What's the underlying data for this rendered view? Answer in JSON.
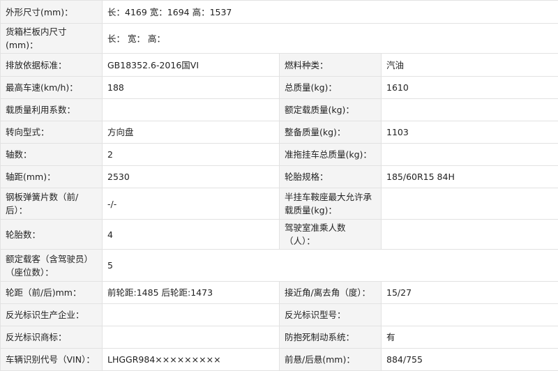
{
  "rows": [
    {
      "l1": "外形尺寸(mm)：",
      "v1": "长：4169 宽：1694 高：1537"
    },
    {
      "l1": "货箱栏板内尺寸(mm)：",
      "v1": "长： 宽： 高："
    },
    {
      "l1": "排放依据标准：",
      "v1": "GB18352.6-2016国VI",
      "l2": "燃料种类：",
      "v2": "汽油"
    },
    {
      "l1": "最高车速(km/h)：",
      "v1": "188",
      "l2": "总质量(kg)：",
      "v2": "1610"
    },
    {
      "l1": "载质量利用系数：",
      "v1": "",
      "l2": "额定载质量(kg)：",
      "v2": ""
    },
    {
      "l1": "转向型式：",
      "v1": "方向盘",
      "l2": "整备质量(kg)：",
      "v2": "1103"
    },
    {
      "l1": "轴数：",
      "v1": "2",
      "l2": "准拖挂车总质量(kg)：",
      "v2": ""
    },
    {
      "l1": "轴距(mm)：",
      "v1": "2530",
      "l2": "轮胎规格：",
      "v2": "185/60R15 84H"
    },
    {
      "l1": "钢板弹簧片数（前/后）：",
      "v1": "-/-",
      "l2": "半挂车鞍座最大允许承载质量(kg)：",
      "v2": ""
    },
    {
      "l1": "轮胎数：",
      "v1": "4",
      "l2": "驾驶室准乘人数（人）：",
      "v2": ""
    },
    {
      "l1": "额定载客（含驾驶员）（座位数）：",
      "v1": "5"
    },
    {
      "l1": "轮距（前/后)mm：",
      "v1": "前轮距:1485 后轮距:1473",
      "l2": "接近角/离去角（度）：",
      "v2": "15/27"
    },
    {
      "l1": "反光标识生产企业：",
      "v1": "",
      "l2": "反光标识型号：",
      "v2": ""
    },
    {
      "l1": "反光标识商标：",
      "v1": "",
      "l2": "防抱死制动系统：",
      "v2": "有"
    },
    {
      "l1": "车辆识别代号（VIN）：",
      "v1": "LHGGR984×××××××××",
      "l2": "前悬/后悬(mm)：",
      "v2": "884/755"
    }
  ]
}
